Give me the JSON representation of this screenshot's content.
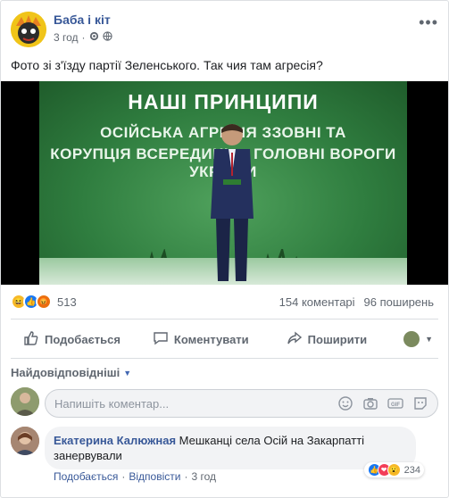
{
  "page": {
    "name": "Баба і кіт",
    "time": "3 год",
    "privacy_icon": "globe-icon"
  },
  "post": {
    "text": "Фото зі з'їзду партії Зеленського. Так чия там агресія?",
    "image_slide": {
      "title": "НАШІ ПРИНЦИПИ",
      "line1": "ОСІЙСЬКА АГРЕСІЯ ЗЗОВНІ ТА",
      "line2": "КОРУПЦІЯ ВСЕРЕДИНІ — ГОЛОВНІ ВОРОГИ УКРАЇНИ"
    }
  },
  "reactions": {
    "count": "513",
    "types": [
      "haha",
      "like",
      "angry"
    ],
    "colors": {
      "haha": "#f7b928",
      "like": "#1877f2",
      "angry": "#e9710f"
    }
  },
  "stats": {
    "comments": "154 коментарі",
    "shares": "96 поширень"
  },
  "actions": {
    "like": "Подобається",
    "comment": "Коментувати",
    "share": "Поширити"
  },
  "comments_section": {
    "sort_label": "Найдовідповідніші",
    "composer_placeholder": "Напишіть коментар...",
    "items": [
      {
        "author": "Екатерина Калюжная",
        "text": "Мешканці села Осій на Закарпатті занервували",
        "like_label": "Подобається",
        "reply_label": "Відповісти",
        "time": "3 год",
        "reaction_count": "234"
      }
    ]
  }
}
